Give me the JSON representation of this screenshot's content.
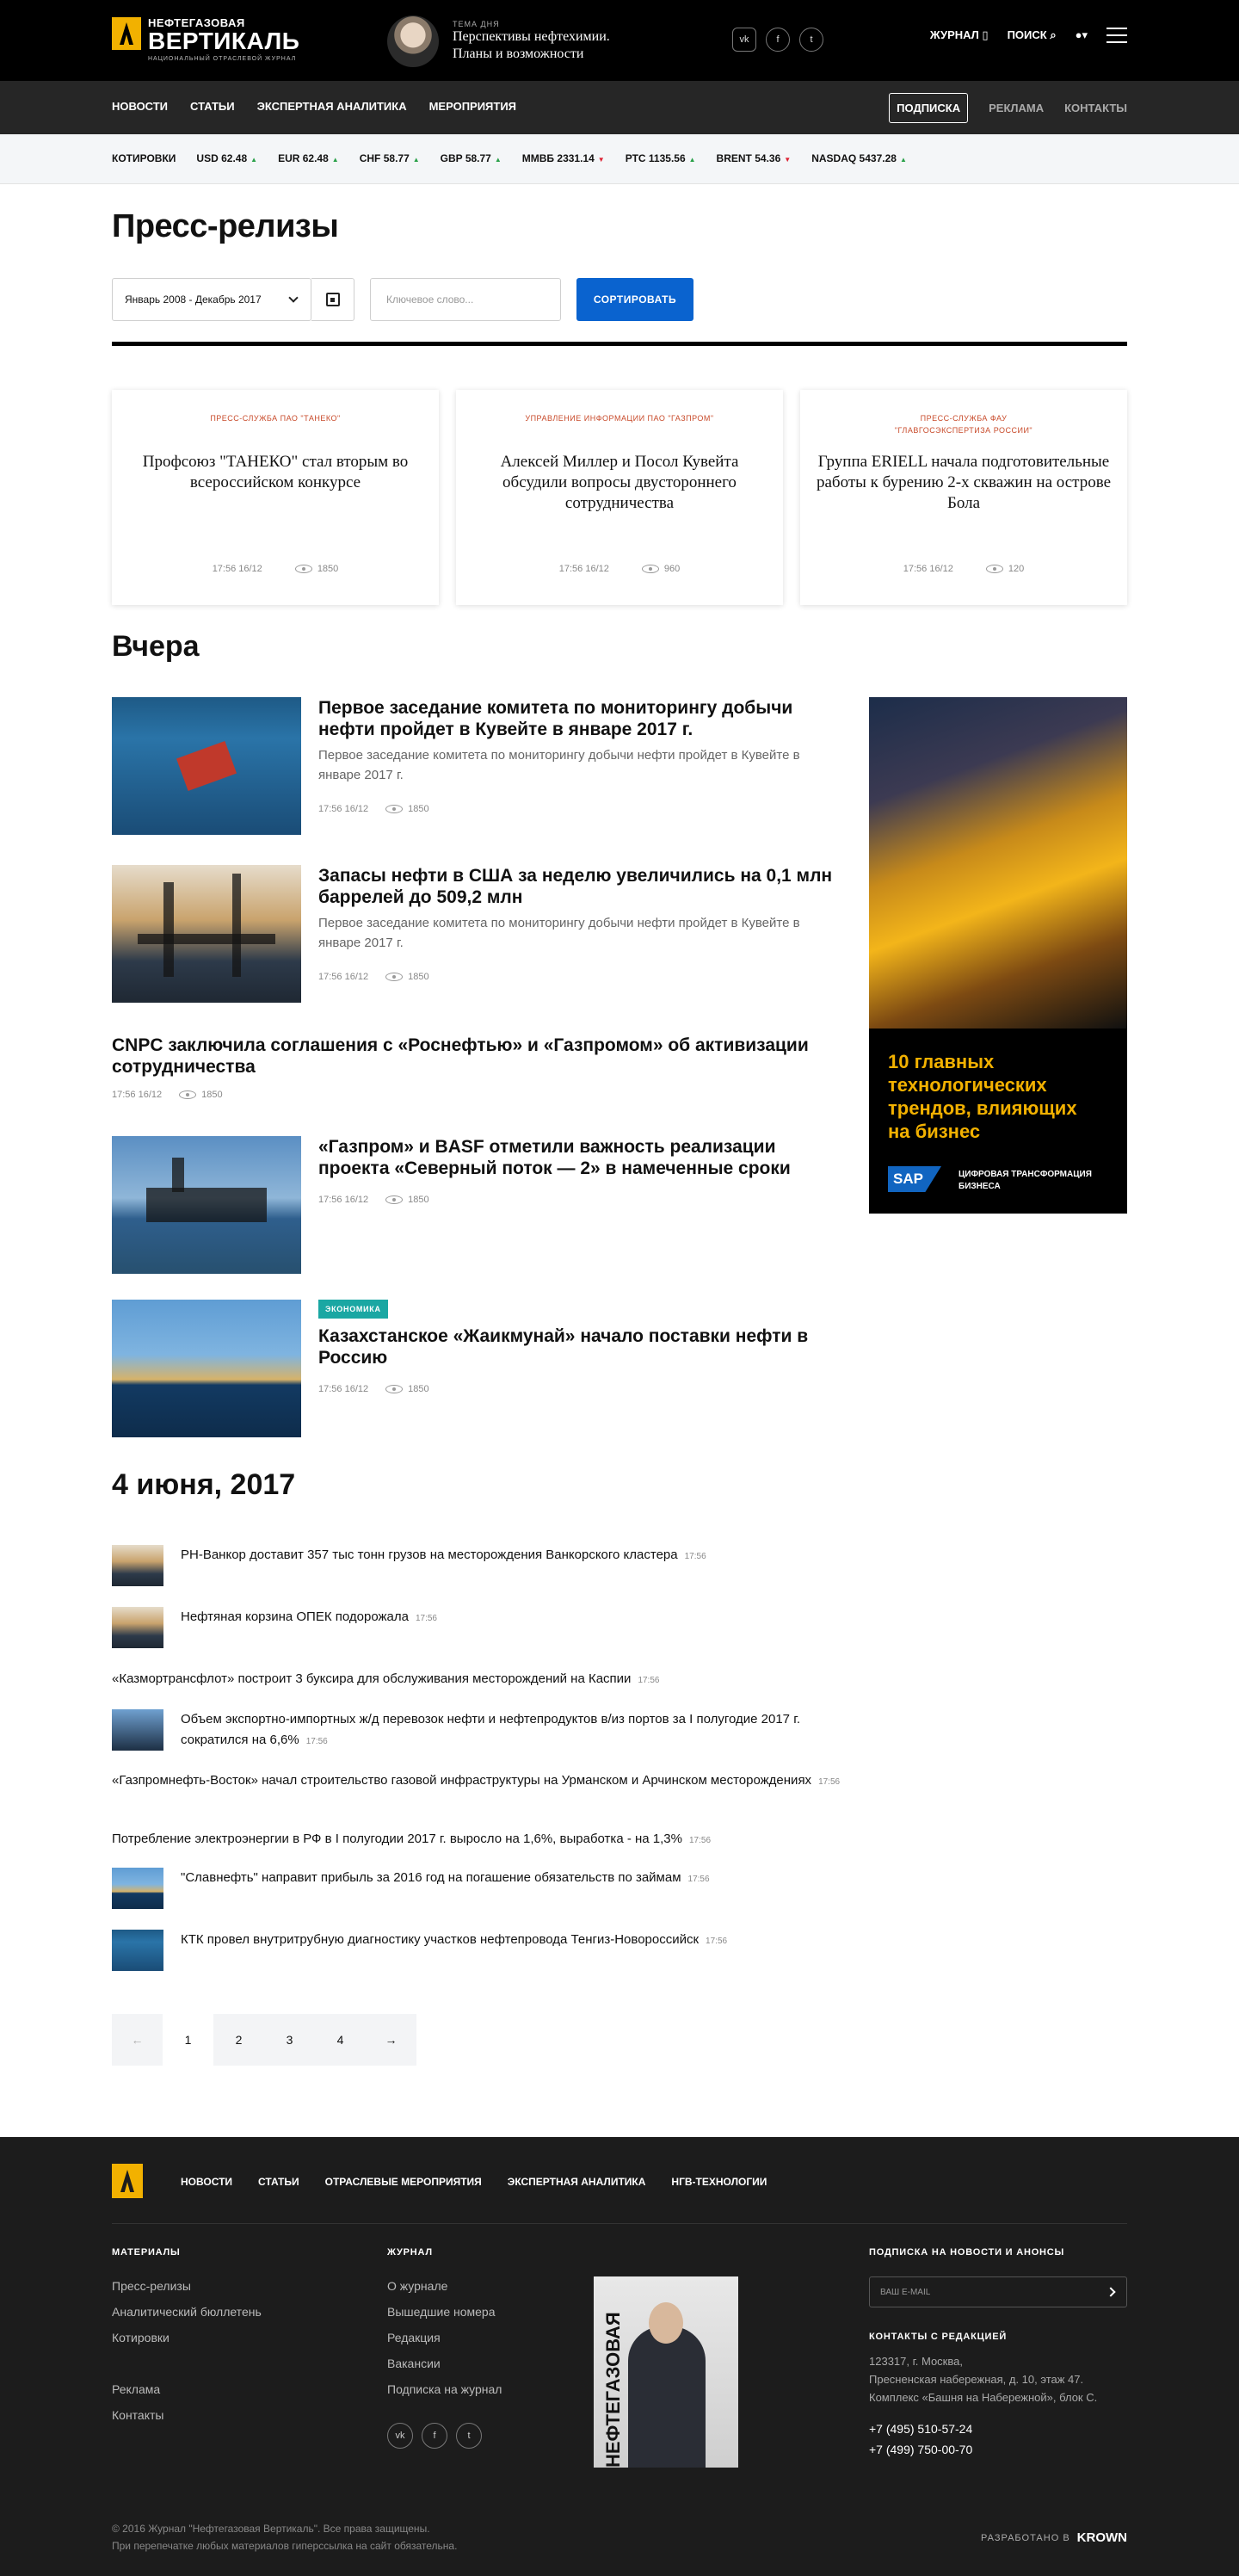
{
  "header": {
    "logo": {
      "line1": "НЕФТЕГАЗОВАЯ",
      "line2": "ВЕРТИКАЛЬ",
      "line3": "НАЦИОНАЛЬНЫЙ ОТРАСЛЕВОЙ ЖУРНАЛ"
    },
    "theme": {
      "label": "ТЕМА ДНЯ",
      "title_line1": "Перспективы нефтехимии.",
      "title_line2": "Планы и возможности"
    },
    "social": [
      "vk",
      "f",
      "t"
    ],
    "journal": "ЖУРНАЛ",
    "search": "ПОИСК"
  },
  "nav": {
    "left": [
      "НОВОСТИ",
      "СТАТЬИ",
      "ЭКСПЕРТНАЯ АНАЛИТИКА",
      "МЕРОПРИЯТИЯ"
    ],
    "subscribe": "ПОДПИСКА",
    "ads": "РЕКЛАМА",
    "contacts": "КОНТАКТЫ"
  },
  "quotes": {
    "label": "КОТИРОВКИ",
    "items": [
      {
        "name": "USD",
        "value": "62.48",
        "dir": "up"
      },
      {
        "name": "EUR",
        "value": "62.48",
        "dir": "up"
      },
      {
        "name": "CHF",
        "value": "58.77",
        "dir": "up"
      },
      {
        "name": "GBP",
        "value": "58.77",
        "dir": "up"
      },
      {
        "name": "ММВБ",
        "value": "2331.14",
        "dir": "dn"
      },
      {
        "name": "РТС",
        "value": "1135.56",
        "dir": "up"
      },
      {
        "name": "BRENT",
        "value": "54.36",
        "dir": "dn"
      },
      {
        "name": "NASDAQ",
        "value": "5437.28",
        "dir": "up"
      }
    ]
  },
  "page": {
    "title": "Пресс-релизы",
    "period": "Январь 2008 - Декабрь 2017",
    "keyword_placeholder": "Ключевое слово...",
    "sort": "СОРТИРОВАТЬ"
  },
  "cards": [
    {
      "source": "ПРЕСС-СЛУЖБА ПАО \"ТАНЕКО\"",
      "source2": "",
      "title": "Профсоюз \"ТАНЕКО\" стал вторым во всероссийском конкурсе",
      "time": "17:56 16/12",
      "views": "1850"
    },
    {
      "source": "УПРАВЛЕНИЕ ИНФОРМАЦИИ ПАО \"ГАЗПРОМ\"",
      "source2": "",
      "title": "Алексей Миллер и Посол Кувейта обсудили вопросы двустороннего сотрудничества",
      "time": "17:56 16/12",
      "views": "960"
    },
    {
      "source": "ПРЕСС-СЛУЖБА ФАУ",
      "source2": "\"ГЛАВГОСЭКСПЕРТИЗА РОССИИ\"",
      "title": "Группа ERIELL начала подготовительные работы к бурению 2-х скважин на острове Бола",
      "time": "17:56 16/12",
      "views": "120"
    }
  ],
  "yesterday": {
    "heading": "Вчера",
    "articles": [
      {
        "title": "Первое заседание комитета по мониторингу добычи нефти пройдет в Кувейте в январе 2017 г.",
        "lead": "Первое заседание комитета по мониторингу добычи нефти пройдет в Кувейте в январе 2017 г.",
        "time": "17:56 16/12",
        "views": "1850"
      },
      {
        "title": "Запасы нефти в США за неделю увеличились на 0,1 млн баррелей до 509,2 млн",
        "lead": "Первое заседание комитета по мониторингу добычи нефти пройдет в Кувейте в январе 2017 г.",
        "time": "17:56 16/12",
        "views": "1850"
      },
      {
        "title": "CNPC заключила соглашения с «Роснефтью» и «Газпромом» об активизации сотрудничества",
        "time": "17:56 16/12",
        "views": "1850"
      },
      {
        "title": "«Газпром» и BASF отметили важность реализации проекта «Северный поток — 2» в намеченные сроки",
        "time": "17:56 16/12",
        "views": "1850"
      },
      {
        "tag": "ЭКОНОМИКА",
        "title": "Казахстанское «Жаикмунай» начало поставки нефти в Россию",
        "time": "17:56 16/12",
        "views": "1850"
      }
    ]
  },
  "ad": {
    "text_line1": "10 главных",
    "text_line2": "технологических",
    "text_line3": "трендов, влияющих",
    "text_line4": "на бизнес",
    "brand": "SAP",
    "cap_line1": "ЦИФРОВАЯ ТРАНСФОРМАЦИЯ",
    "cap_line2": "БИЗНЕСА"
  },
  "june": {
    "heading": "4 июня, 2017",
    "items": [
      {
        "text": "РН-Ванкор доставит 357 тыс тонн грузов на месторождения Ванкорского кластера",
        "time": "17:56"
      },
      {
        "text": "Нефтяная корзина ОПЕК подорожала",
        "time": "17:56"
      },
      {
        "text": "«Казмортрансфлот» построит 3 буксира для обслуживания месторождений на Каспии",
        "time": "17:56"
      },
      {
        "text": "Объем экспортно-импортных ж/д перевозок нефти и нефтепродуктов в/из портов за I полугодие 2017 г. сократился на 6,6%",
        "time": "17:56"
      },
      {
        "text": "«Газпромнефть-Восток» начал строительство газовой инфраструктуры на Урманском и Арчинском месторождениях",
        "time": "17:56"
      },
      {
        "text": "Потребление электроэнергии в РФ в I полугодии 2017 г. выросло на 1,6%, выработка - на 1,3%",
        "time": "17:56"
      },
      {
        "text": "\"Славнефть\" направит прибыль за 2016 год на погашение обязательств по займам",
        "time": "17:56"
      },
      {
        "text": "КТК провел внутритрубную диагностику участков нефтепровода Тенгиз-Новороссийск",
        "time": "17:56"
      }
    ]
  },
  "pagination": {
    "prev": "←",
    "pages": [
      "1",
      "2",
      "3",
      "4"
    ],
    "next": "→",
    "current": "1"
  },
  "footer": {
    "nav": [
      "НОВОСТИ",
      "СТАТЬИ",
      "ОТРАСЛЕВЫЕ МЕРОПРИЯТИЯ",
      "ЭКСПЕРТНАЯ АНАЛИТИКА",
      "НГВ-ТЕХНОЛОГИИ"
    ],
    "materials_h": "МАТЕРИАЛЫ",
    "materials": [
      "Пресс-релизы",
      "Аналитический бюллетень",
      "Котировки"
    ],
    "materials2": [
      "Реклама",
      "Контакты"
    ],
    "journal_h": "ЖУРНАЛ",
    "journal": [
      "О журнале",
      "Вышедшие номера",
      "Редакция",
      "Вакансии",
      "Подписка на журнал"
    ],
    "cover_title": "НЕФТЕГАЗОВАЯ ВЕРТИКАЛЬ",
    "subscribe_h": "ПОДПИСКА НА НОВОСТИ И АНОНСЫ",
    "email_placeholder": "ВАШ E-MAIL",
    "contacts_h": "КОНТАКТЫ С РЕДАКЦИЕЙ",
    "addr1": "123317, г. Москва,",
    "addr2": "Пресненская набережная, д. 10, этаж 47.",
    "addr3": "Комплекс «Башня на Набережной», блок С.",
    "phone1": "+7 (495) 510-57-24",
    "phone2": "+7 (499) 750-00-70",
    "copy1": "© 2016 Журнал \"Нефтегазовая Вертикаль\". Все права защищены.",
    "copy2": "При перепечатке любых материалов гиперссылка на сайт обязательна.",
    "dev_label": "РАЗРАБОТАНО В",
    "dev_brand": "KROWN"
  }
}
